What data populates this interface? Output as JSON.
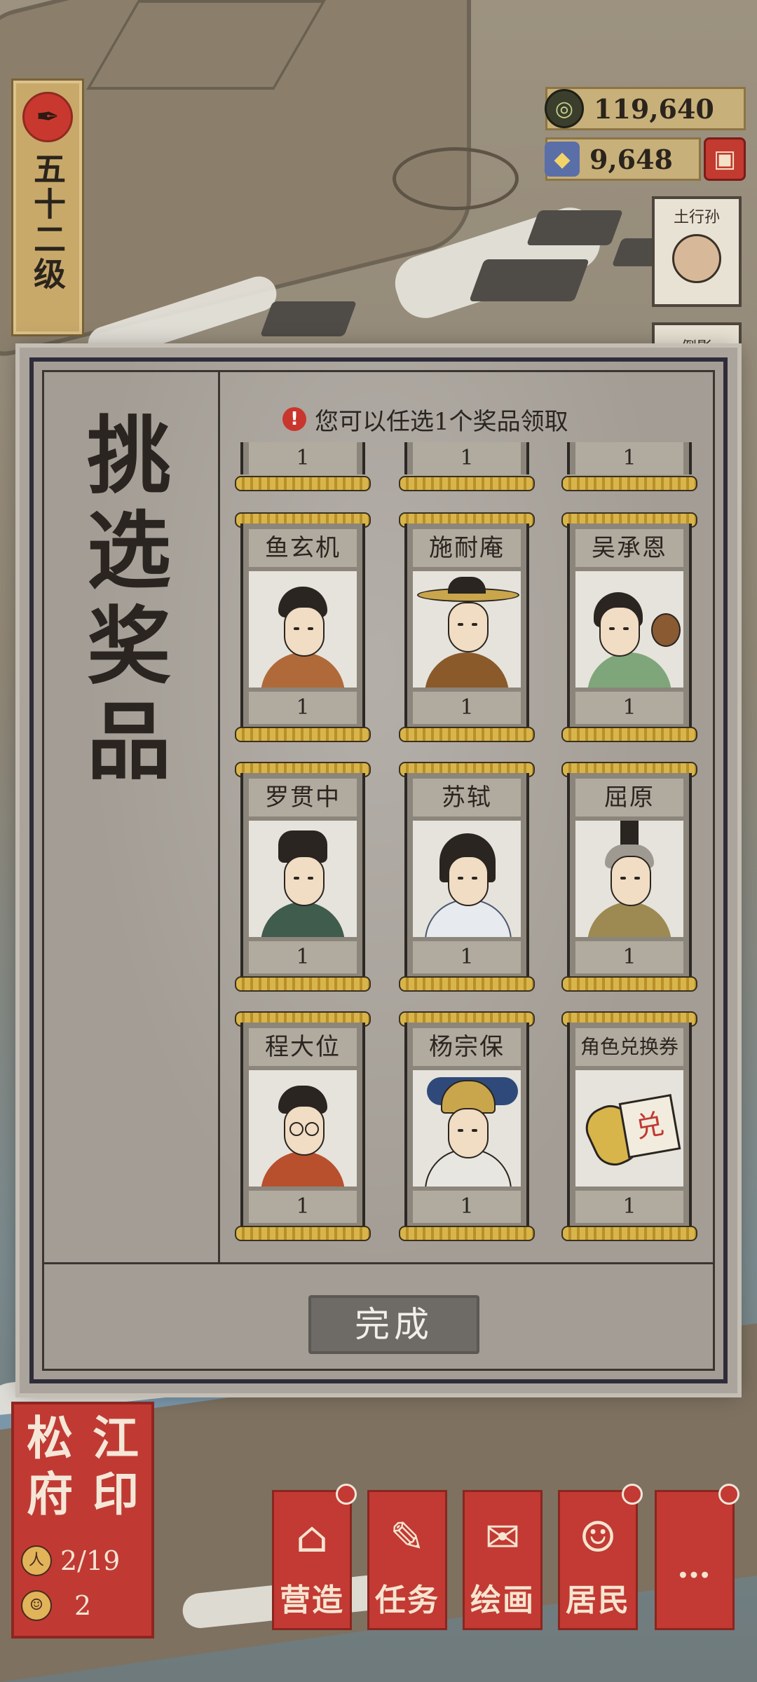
{
  "player": {
    "level": "五十二级"
  },
  "currencies": [
    {
      "icon": "coin-icon",
      "value": "119,640"
    },
    {
      "icon": "gem-icon",
      "value": "9,648"
    }
  ],
  "map_signs": [
    "土行孙",
    "倒影"
  ],
  "dialog": {
    "title": "挑选奖品",
    "hint": "您可以任选1个奖品领取",
    "top_row_counts": [
      "1",
      "1",
      "1"
    ],
    "rewards": [
      {
        "name": "鱼玄机",
        "count": "1"
      },
      {
        "name": "施耐庵",
        "count": "1"
      },
      {
        "name": "吴承恩",
        "count": "1"
      },
      {
        "name": "罗贯中",
        "count": "1"
      },
      {
        "name": "苏轼",
        "count": "1"
      },
      {
        "name": "屈原",
        "count": "1"
      },
      {
        "name": "程大位",
        "count": "1"
      },
      {
        "name": "杨宗保",
        "count": "1"
      },
      {
        "name": "角色兑换券",
        "count": "1"
      }
    ],
    "done_label": "完成"
  },
  "seal": {
    "title_chars": [
      "松",
      "江",
      "府",
      "印"
    ],
    "residents": "2/19",
    "tasks": "2"
  },
  "nav": [
    {
      "label": "营造",
      "icon": "building-icon"
    },
    {
      "label": "任务",
      "icon": "task-book-icon"
    },
    {
      "label": "绘画",
      "icon": "scroll-painting-icon"
    },
    {
      "label": "居民",
      "icon": "resident-icon"
    },
    {
      "label": "…",
      "icon": "more-icon"
    }
  ],
  "colors": {
    "seal_red": "#c03a33",
    "gold": "#c8a96a",
    "panel": "#a39d95"
  }
}
